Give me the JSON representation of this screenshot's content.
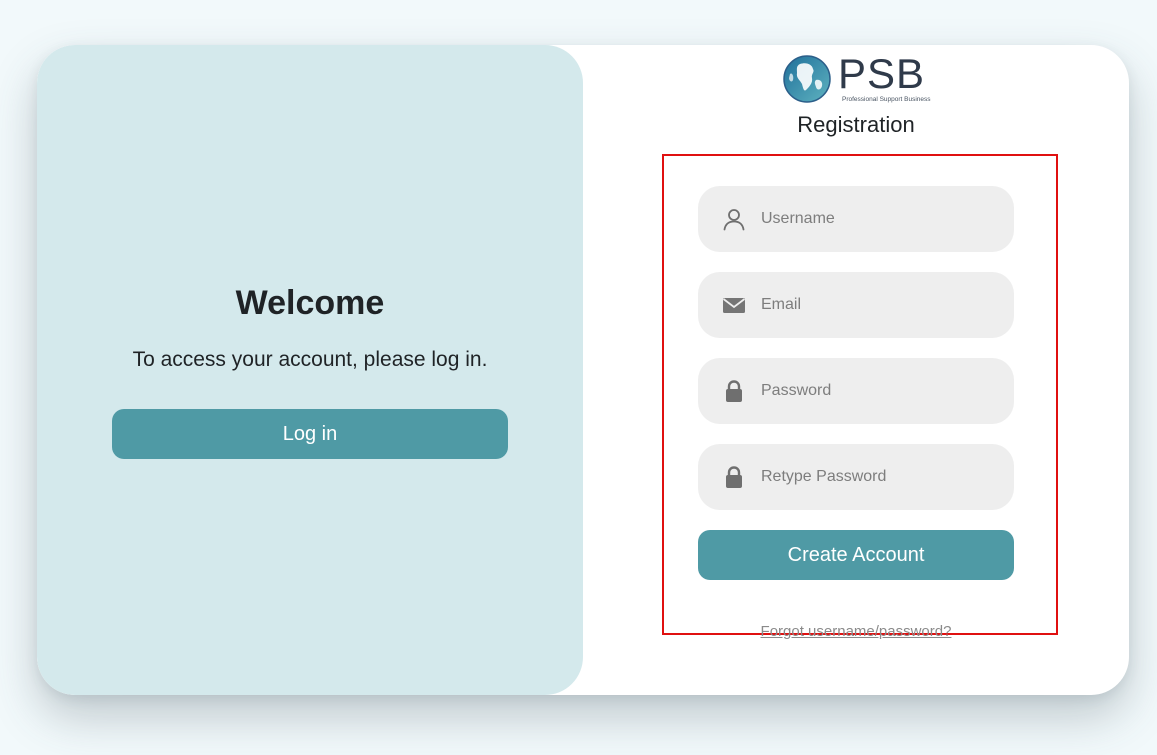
{
  "left_panel": {
    "title": "Welcome",
    "text": "To access your account, please log in.",
    "login_button": "Log in"
  },
  "logo": {
    "name": "PSB",
    "tagline": "Professional Support Business"
  },
  "registration": {
    "title": "Registration",
    "fields": [
      {
        "icon": "user-icon",
        "placeholder": "Username",
        "value": ""
      },
      {
        "icon": "envelope-icon",
        "placeholder": "Email",
        "value": ""
      },
      {
        "icon": "lock-icon",
        "placeholder": "Password",
        "value": ""
      },
      {
        "icon": "lock-icon",
        "placeholder": "Retype Password",
        "value": ""
      }
    ],
    "create_button": "Create Account",
    "forgot_link": "Forgot username/password?"
  },
  "colors": {
    "accent": "#4f9aa5",
    "left_panel_bg": "#d4e9ec",
    "field_bg": "#eeeeee",
    "highlight": "#e01010"
  }
}
